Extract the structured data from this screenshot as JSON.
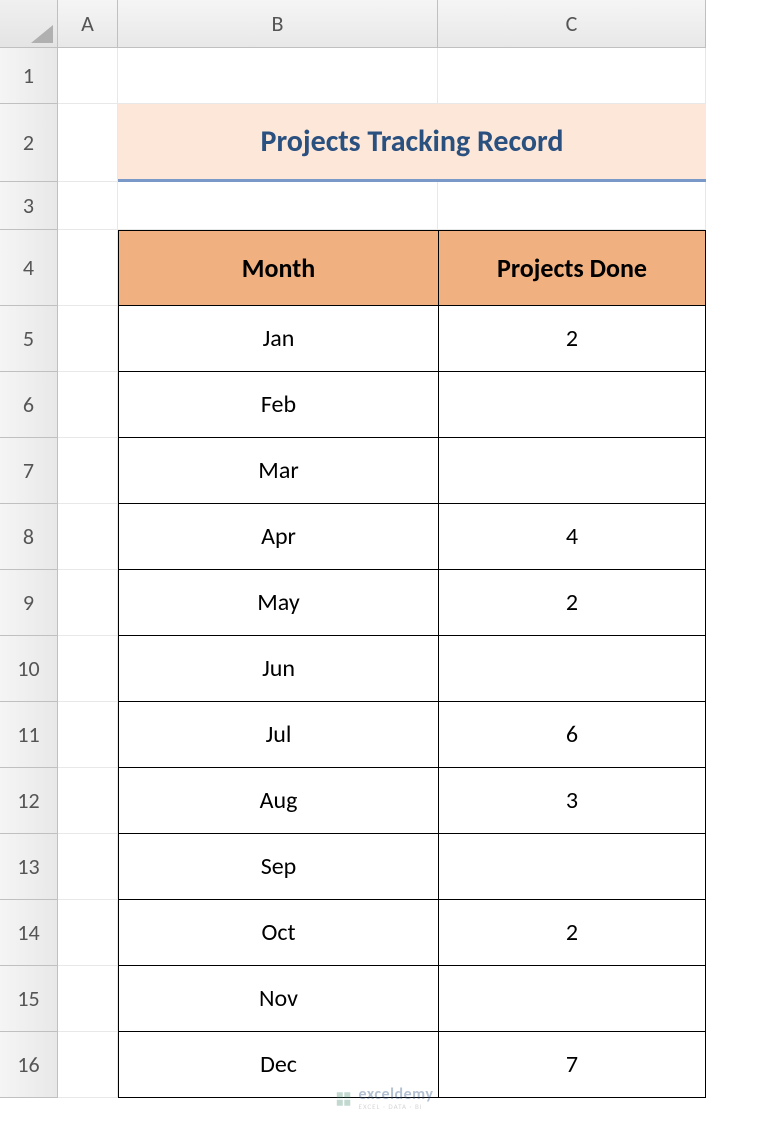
{
  "columns": [
    "A",
    "B",
    "C"
  ],
  "rows": [
    "1",
    "2",
    "3",
    "4",
    "5",
    "6",
    "7",
    "8",
    "9",
    "10",
    "11",
    "12",
    "13",
    "14",
    "15",
    "16"
  ],
  "title": "Projects Tracking Record",
  "table": {
    "headers": {
      "month": "Month",
      "projects_done": "Projects Done"
    },
    "data": [
      {
        "month": "Jan",
        "value": "2"
      },
      {
        "month": "Feb",
        "value": ""
      },
      {
        "month": "Mar",
        "value": ""
      },
      {
        "month": "Apr",
        "value": "4"
      },
      {
        "month": "May",
        "value": "2"
      },
      {
        "month": "Jun",
        "value": ""
      },
      {
        "month": "Jul",
        "value": "6"
      },
      {
        "month": "Aug",
        "value": "3"
      },
      {
        "month": "Sep",
        "value": ""
      },
      {
        "month": "Oct",
        "value": "2"
      },
      {
        "month": "Nov",
        "value": ""
      },
      {
        "month": "Dec",
        "value": "7"
      }
    ]
  },
  "watermark": {
    "main": "exceldemy",
    "sub": "EXCEL · DATA · BI"
  }
}
